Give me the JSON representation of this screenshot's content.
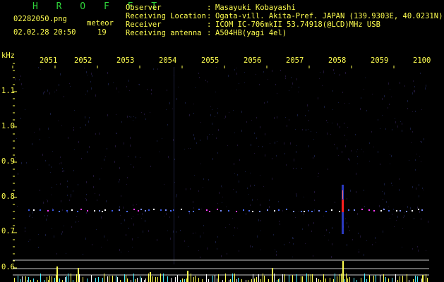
{
  "header": {
    "brand": "H R O F F T",
    "filename": "02282050.png",
    "datetime": "02.02.28 20:50",
    "meteor_label": "meteor",
    "meteor_count": "19",
    "info": [
      {
        "key": "Observer",
        "value": "Masayuki Kobayashi"
      },
      {
        "key": "Receiving Location",
        "value": "Ogata-vill. Akita-Pref. JAPAN (139.9303E, 40.0231N)"
      },
      {
        "key": "Receiver",
        "value": "ICOM IC-706mkII 53.74918(@LCD)MHz USB"
      },
      {
        "key": "Receiving antenna",
        "value": "A504HB(yagi 4el)"
      }
    ]
  },
  "plot": {
    "y_unit": "kHz",
    "y_ticks": [
      "1.1",
      "1.0",
      "0.9",
      "0.8",
      "0.7",
      "0.6"
    ],
    "x_ticks": [
      "2051",
      "2052",
      "2053",
      "2054",
      "2055",
      "2056",
      "2057",
      "2058",
      "2059",
      "2100"
    ],
    "colors": {
      "tick_text": "#ffff50",
      "grid": "#c8c8c8",
      "bright_trace": "#ff2020",
      "echo_blue": "#4a6bff"
    }
  }
}
